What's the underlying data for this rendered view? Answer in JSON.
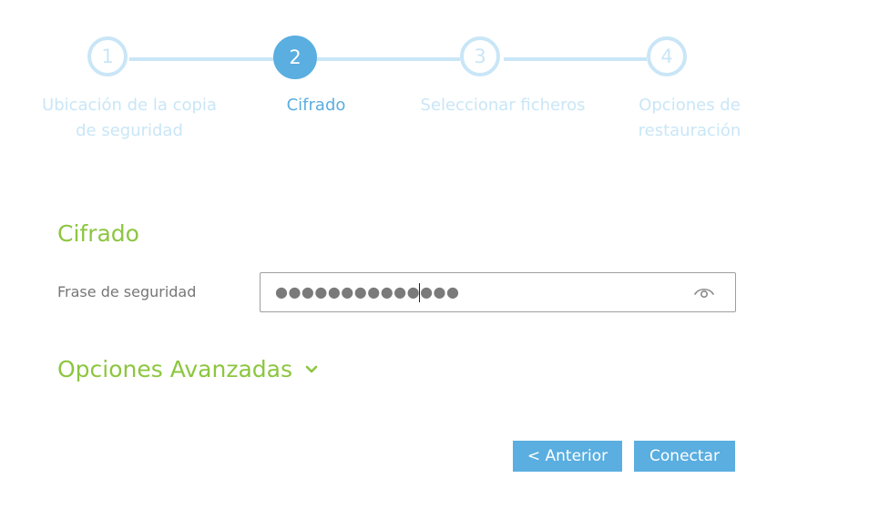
{
  "stepper": {
    "steps": [
      {
        "number": "1",
        "label": "Ubicación de la copia de seguridad",
        "state": "inactive"
      },
      {
        "number": "2",
        "label": "Cifrado",
        "state": "active"
      },
      {
        "number": "3",
        "label": "Seleccionar ficheros",
        "state": "inactive"
      },
      {
        "number": "4",
        "label": "Opciones de restauración",
        "state": "inactive"
      }
    ]
  },
  "form": {
    "section_title": "Cifrado",
    "passphrase": {
      "label": "Frase de seguridad",
      "masked_value": "●●●●●●●●●●●●●●",
      "reveal_icon": "eye-icon"
    },
    "advanced": {
      "label": "Opciones Avanzadas",
      "icon": "chevron-down-icon"
    }
  },
  "actions": {
    "previous_label": "< Anterior",
    "connect_label": "Conectar"
  },
  "colors": {
    "accent_blue": "#5aaee0",
    "inactive_blue": "#c9e6f7",
    "accent_green": "#8cc63f",
    "label_gray": "#777777"
  }
}
